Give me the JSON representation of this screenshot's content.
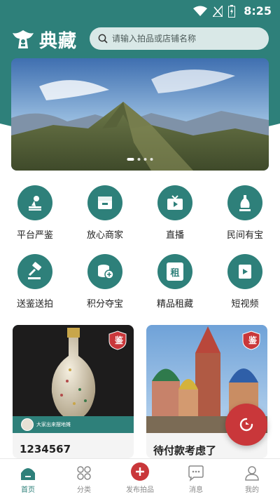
{
  "status_bar": {
    "time": "8:25"
  },
  "header": {
    "logo_text": "典藏",
    "search": {
      "placeholder": "请输入拍品或店铺名称"
    }
  },
  "banner": {
    "slide_count": 4,
    "active_slide": 1
  },
  "features": [
    {
      "label": "平台严鉴",
      "icon": "appraise-stamp-icon"
    },
    {
      "label": "放心商家",
      "icon": "store-icon"
    },
    {
      "label": "直播",
      "icon": "live-tv-icon"
    },
    {
      "label": "民间有宝",
      "icon": "vase-icon"
    },
    {
      "label": "送鉴送拍",
      "icon": "auction-hammer-icon"
    },
    {
      "label": "积分夺宝",
      "icon": "coins-icon"
    },
    {
      "label": "精品租藏",
      "icon": "rent-icon",
      "glyph": "租"
    },
    {
      "label": "短视频",
      "icon": "video-icon"
    }
  ],
  "cards": [
    {
      "title": "1234567",
      "badge": "鉴",
      "seller": "大家出来摆地摊"
    },
    {
      "title": "待付款考虑了",
      "badge": "鉴"
    }
  ],
  "tabs": [
    {
      "label": "首页",
      "icon": "home-icon",
      "active": true
    },
    {
      "label": "分类",
      "icon": "category-icon"
    },
    {
      "label": "发布拍品",
      "icon": "publish-icon"
    },
    {
      "label": "消息",
      "icon": "message-icon"
    },
    {
      "label": "我的",
      "icon": "profile-icon"
    }
  ],
  "colors": {
    "accent": "#2e807a",
    "danger": "#c9373a",
    "tab_inactive": "#8a8a8a"
  }
}
